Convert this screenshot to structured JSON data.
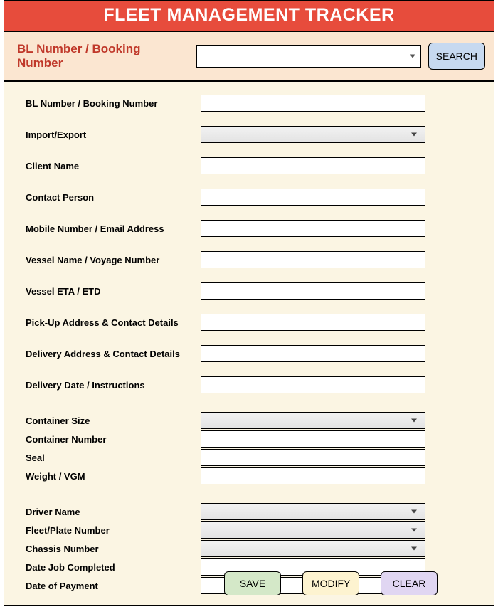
{
  "title": "FLEET MANAGEMENT TRACKER",
  "search": {
    "label": "BL Number / Booking Number",
    "value": "",
    "button": "SEARCH"
  },
  "fields": {
    "bl_number": {
      "label": "BL Number / Booking Number",
      "value": ""
    },
    "import_export": {
      "label": "Import/Export",
      "value": ""
    },
    "client_name": {
      "label": "Client Name",
      "value": ""
    },
    "contact_person": {
      "label": "Contact Person",
      "value": ""
    },
    "mobile_email": {
      "label": "Mobile Number / Email Address",
      "value": ""
    },
    "vessel_voyage": {
      "label": "Vessel Name / Voyage Number",
      "value": ""
    },
    "eta_etd": {
      "label": "Vessel ETA / ETD",
      "value": ""
    },
    "pickup": {
      "label": "Pick-Up Address & Contact Details",
      "value": ""
    },
    "delivery": {
      "label": "Delivery Address & Contact Details",
      "value": ""
    },
    "delivery_date": {
      "label": "Delivery Date / Instructions",
      "value": ""
    },
    "container_size": {
      "label": "Container Size",
      "value": ""
    },
    "container_number": {
      "label": "Container Number",
      "value": ""
    },
    "seal": {
      "label": "Seal",
      "value": ""
    },
    "weight_vgm": {
      "label": "Weight / VGM",
      "value": ""
    },
    "driver_name": {
      "label": "Driver Name",
      "value": ""
    },
    "fleet_plate": {
      "label": "Fleet/Plate Number",
      "value": ""
    },
    "chassis_number": {
      "label": "Chassis Number",
      "value": ""
    },
    "date_completed": {
      "label": "Date Job Completed",
      "value": ""
    },
    "date_payment": {
      "label": "Date of Payment",
      "value": ""
    }
  },
  "buttons": {
    "save": "SAVE",
    "modify": "MODIFY",
    "clear": "CLEAR"
  }
}
